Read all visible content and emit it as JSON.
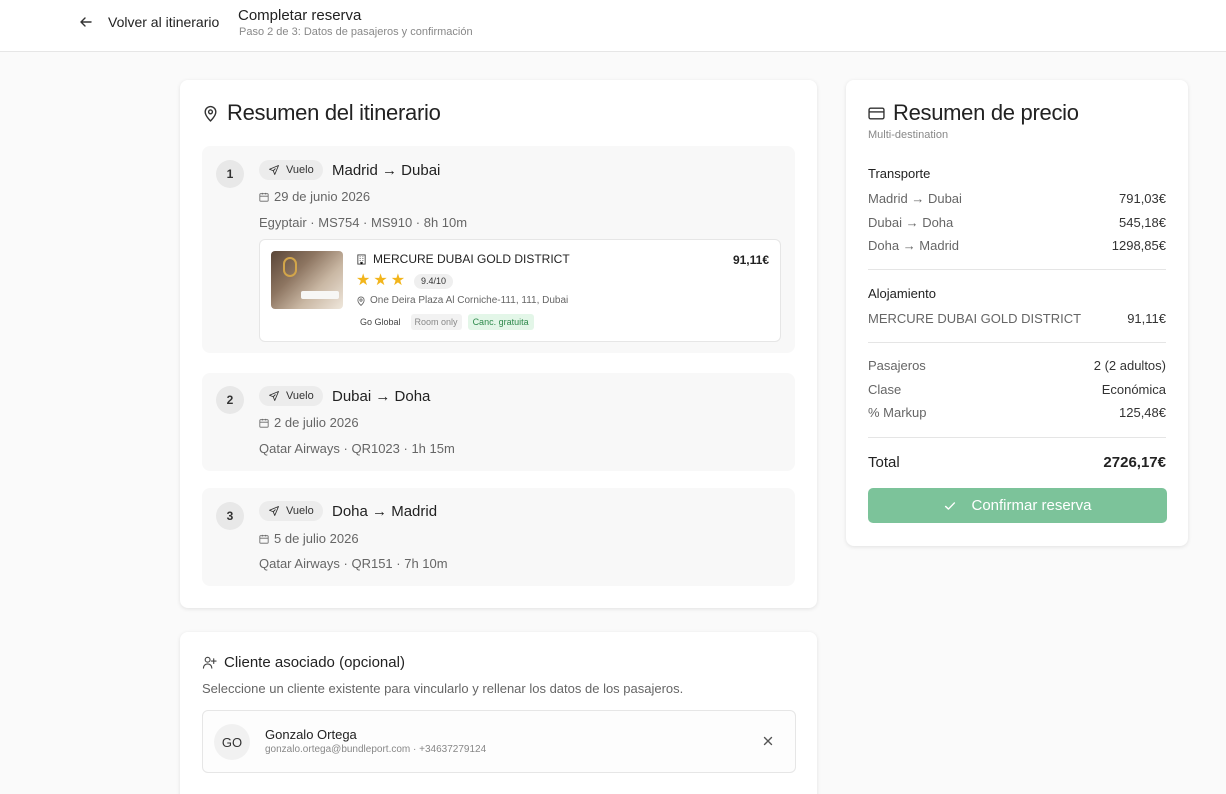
{
  "header": {
    "back_label": "Volver al itinerario",
    "title": "Completar reserva",
    "subtitle": "Paso 2 de 3: Datos de pasajeros y confirmación"
  },
  "itinerary": {
    "title": "Resumen del itinerario",
    "segments": [
      {
        "number": "1",
        "type_label": "Vuelo",
        "route": "Madrid → Dubai",
        "date": "29 de junio 2026",
        "airline": "Egyptair · MS754 · MS910 · 8h 10m",
        "hotel": {
          "name": "MERCURE DUBAI GOLD DISTRICT",
          "price": "91,11€",
          "stars": 3,
          "score": "9.4/10",
          "address": "One Deira Plaza Al Corniche-111, 111, Dubai",
          "tags": [
            "Go Global",
            "Room only",
            "Canc. gratuita"
          ]
        }
      },
      {
        "number": "2",
        "type_label": "Vuelo",
        "route": "Dubai → Doha",
        "date": "2 de julio 2026",
        "airline": "Qatar Airways · QR1023 · 1h 15m"
      },
      {
        "number": "3",
        "type_label": "Vuelo",
        "route": "Doha → Madrid",
        "date": "5 de julio 2026",
        "airline": "Qatar Airways · QR151 · 7h 10m"
      }
    ]
  },
  "price": {
    "title": "Resumen de precio",
    "subtitle": "Multi-destination",
    "transport_label": "Transporte",
    "transport": [
      {
        "label": "Madrid → Dubai",
        "value": "791,03€"
      },
      {
        "label": "Dubai → Doha",
        "value": "545,18€"
      },
      {
        "label": "Doha → Madrid",
        "value": "1298,85€"
      }
    ],
    "lodging_label": "Alojamiento",
    "lodging": [
      {
        "label": "MERCURE DUBAI GOLD DISTRICT",
        "value": "91,11€"
      }
    ],
    "details": [
      {
        "label": "Pasajeros",
        "value": "2 (2 adultos)"
      },
      {
        "label": "Clase",
        "value": "Económica"
      },
      {
        "label": "% Markup",
        "value": "125,48€"
      }
    ],
    "total_label": "Total",
    "total_value": "2726,17€",
    "confirm_label": "Confirmar reserva"
  },
  "client": {
    "title": "Cliente asociado (opcional)",
    "description": "Seleccione un cliente existente para vincularlo y rellenar los datos de los pasajeros.",
    "initials": "GO",
    "name": "Gonzalo Ortega",
    "contact": "gonzalo.ortega@bundleport.com · +34637279124"
  },
  "colors": {
    "accent_green": "#7cc39a",
    "star": "#f2b51c",
    "tag_green_bg": "#e3f6e8"
  }
}
